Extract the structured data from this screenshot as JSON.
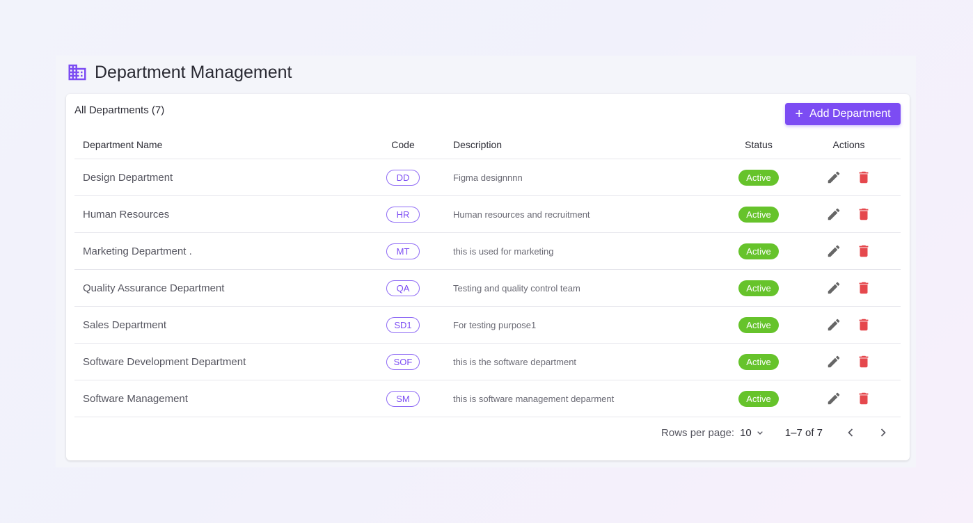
{
  "page": {
    "title": "Department Management",
    "icon": "building-icon",
    "accent_color": "#7c4cf3"
  },
  "card": {
    "heading": "All Departments (7)",
    "add_button_label": "Add Department"
  },
  "table": {
    "columns": [
      "Department Name",
      "Code",
      "Description",
      "Status",
      "Actions"
    ],
    "rows": [
      {
        "name": "Design Department",
        "code": "DD",
        "description": "Figma designnnn",
        "status": "Active"
      },
      {
        "name": "Human Resources",
        "code": "HR",
        "description": "Human resources and recruitment",
        "status": "Active"
      },
      {
        "name": "Marketing Department .",
        "code": "MT",
        "description": "this is used for marketing",
        "status": "Active"
      },
      {
        "name": "Quality Assurance Department",
        "code": "QA",
        "description": "Testing and quality control team",
        "status": "Active"
      },
      {
        "name": "Sales Department",
        "code": "SD1",
        "description": "For testing purpose1",
        "status": "Active"
      },
      {
        "name": "Software Development Department",
        "code": "SOF",
        "description": "this is the software department",
        "status": "Active"
      },
      {
        "name": "Software Management",
        "code": "SM",
        "description": "this is software management deparment",
        "status": "Active"
      }
    ],
    "status_color": "#66c32b",
    "edit_icon": "pencil-icon",
    "delete_icon": "trash-icon",
    "delete_color": "#e5484d"
  },
  "pagination": {
    "rows_per_page_label": "Rows per page:",
    "rows_per_page_value": "10",
    "range": "1–7 of 7"
  }
}
